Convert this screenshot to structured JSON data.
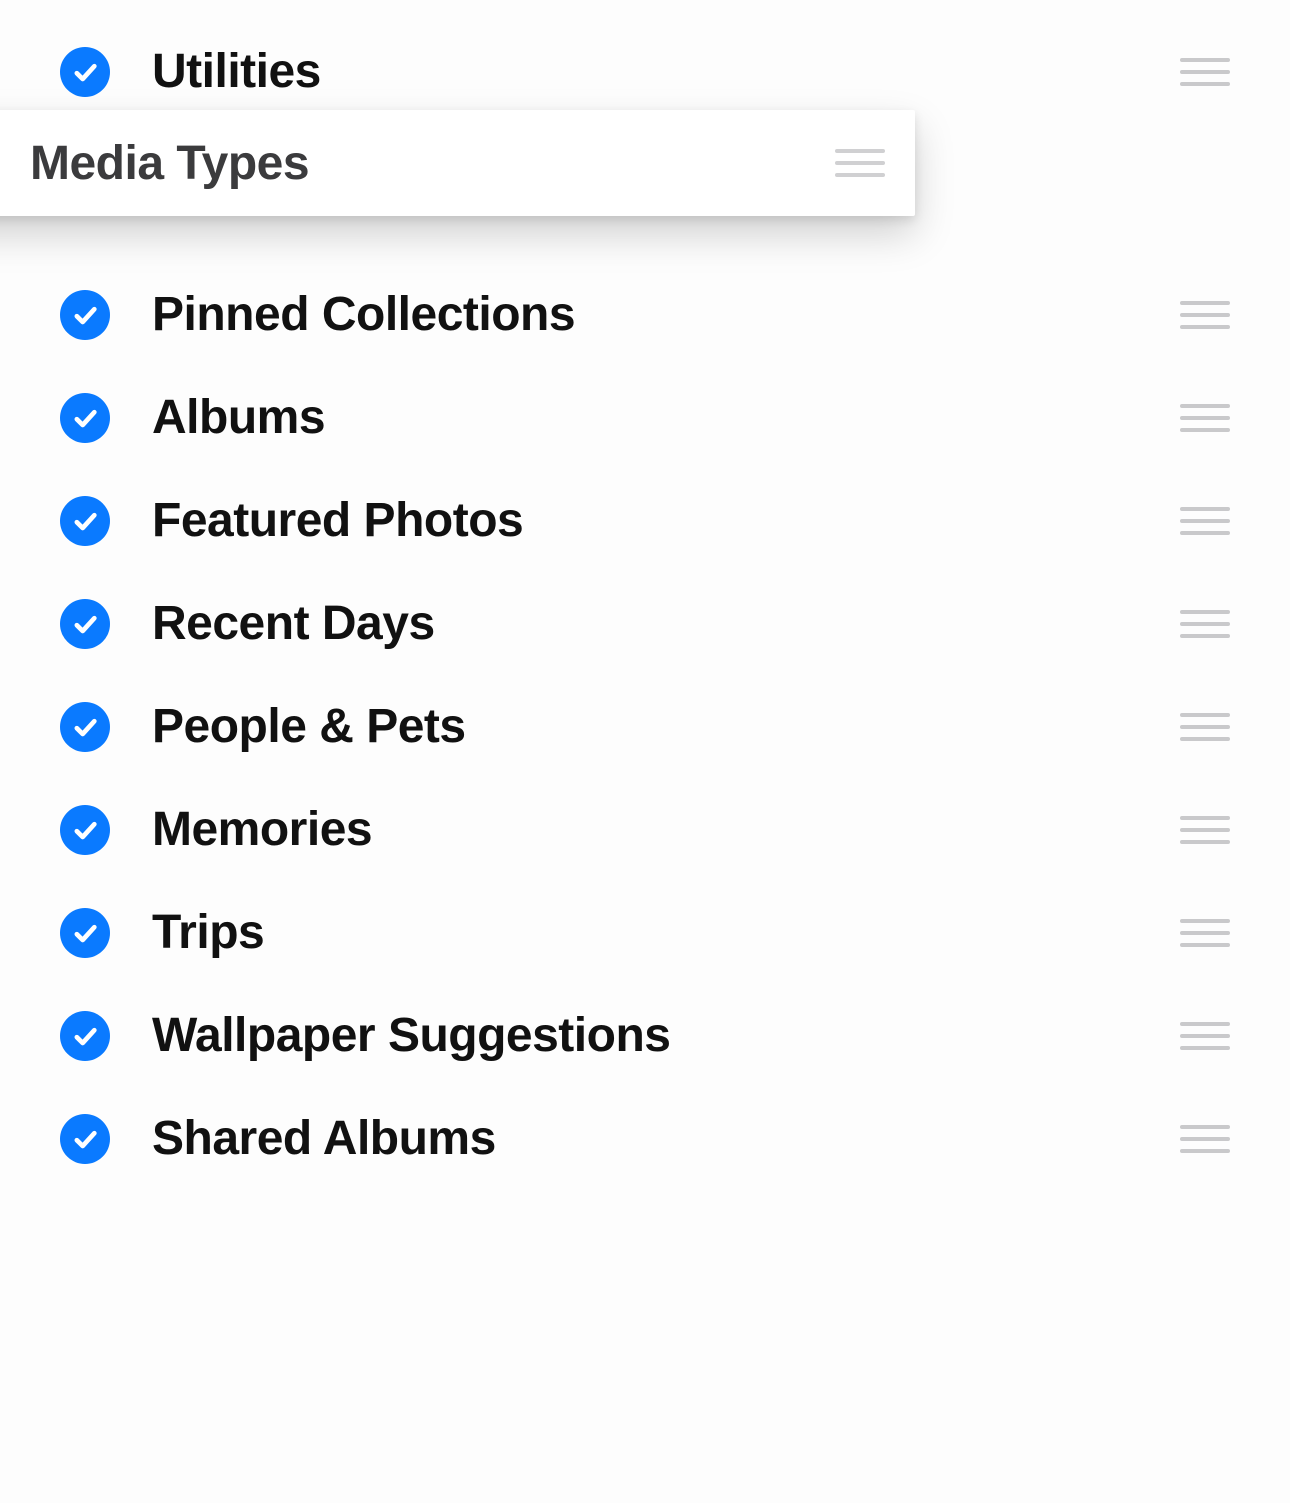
{
  "list": {
    "items": [
      {
        "label": "Utilities",
        "checked": true
      },
      {
        "label": "Media Types",
        "checked": true,
        "dragging": true
      },
      {
        "label": "Pinned Collections",
        "checked": true
      },
      {
        "label": "Albums",
        "checked": true
      },
      {
        "label": "Featured Photos",
        "checked": true
      },
      {
        "label": "Recent Days",
        "checked": true
      },
      {
        "label": "People & Pets",
        "checked": true
      },
      {
        "label": "Memories",
        "checked": true
      },
      {
        "label": "Trips",
        "checked": true
      },
      {
        "label": "Wallpaper Suggestions",
        "checked": true
      },
      {
        "label": "Shared Albums",
        "checked": true
      }
    ]
  },
  "colors": {
    "accent": "#0a7aff"
  }
}
